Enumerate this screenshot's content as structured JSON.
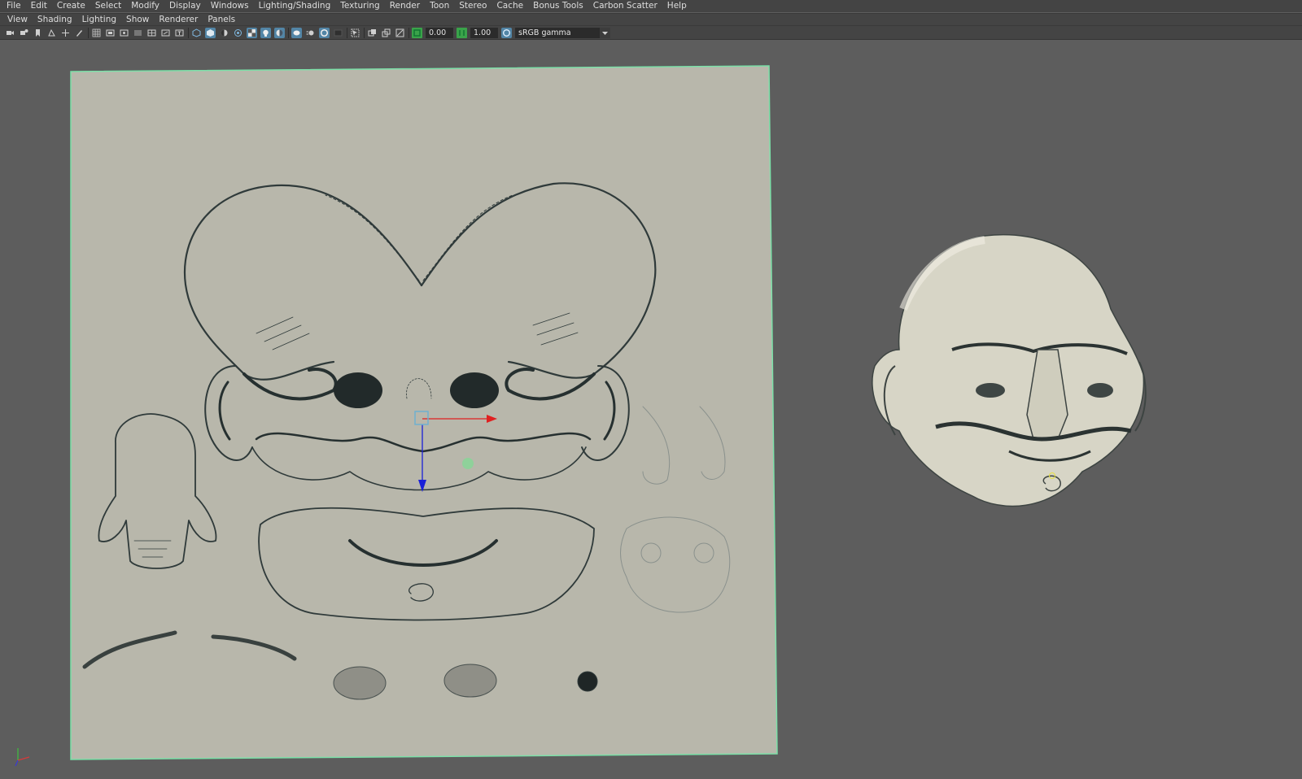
{
  "menubar": {
    "items": [
      "File",
      "Edit",
      "Create",
      "Select",
      "Modify",
      "Display",
      "Windows",
      "Lighting/Shading",
      "Texturing",
      "Render",
      "Toon",
      "Stereo",
      "Cache",
      "Bonus Tools",
      "Carbon Scatter",
      "Help"
    ]
  },
  "panel_menu": {
    "items": [
      "View",
      "Shading",
      "Lighting",
      "Show",
      "Renderer",
      "Panels"
    ]
  },
  "toolbar": {
    "exposure_value": "0.00",
    "gamma_value": "1.00",
    "color_space": "sRGB gamma"
  },
  "viewport": {
    "background_color": "#5d5d5d",
    "texture_plane_color": "#b8b7ab",
    "plane_border_color": "#7be0a8",
    "manipulator_x_color": "#e02020",
    "manipulator_y_color": "#1a20d8",
    "manipulator_center_color": "#6fb0d0"
  }
}
